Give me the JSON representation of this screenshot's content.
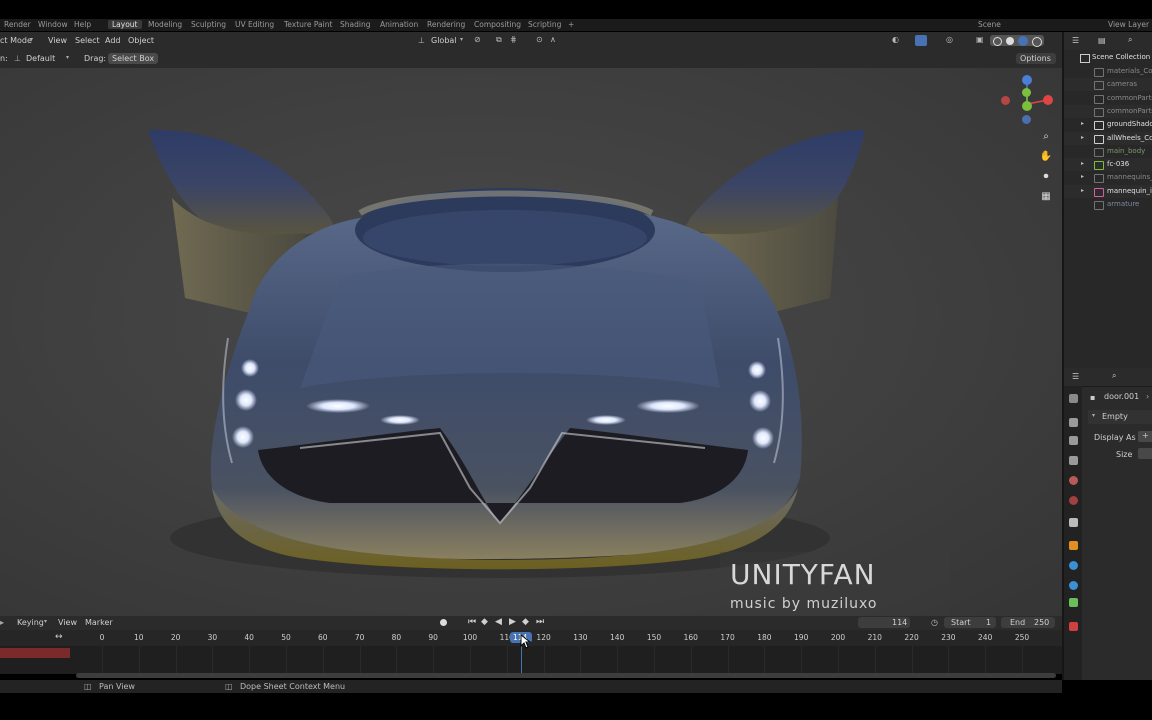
{
  "workspace_tabs": [
    "Layout",
    "Modeling",
    "Sculpting",
    "UV Editing",
    "Texture Paint",
    "Shading",
    "Animation",
    "Rendering",
    "Compositing",
    "Scripting",
    "+"
  ],
  "top_menu_partial": [
    "Render",
    "Window",
    "Help"
  ],
  "scene": {
    "label": "Scene",
    "view_layer": "View Layer"
  },
  "viewport_header": {
    "mode": "ct Mode",
    "menus": [
      "View",
      "Select",
      "Add",
      "Object"
    ],
    "orientation": "Global",
    "orientation_label": "n:",
    "orientation_value": "Default",
    "drag_label": "Drag:",
    "drag_value": "Select Box",
    "options": "Options"
  },
  "watermark": {
    "title": "UNITYFAN",
    "subtitle": "music by muziluxo"
  },
  "timeline": {
    "menus": [
      "Keying",
      "View",
      "Marker"
    ],
    "current_frame": "114",
    "start_label": "Start",
    "start_value": "1",
    "end_label": "End",
    "end_value": "250",
    "frame_marker": "114",
    "ticks": [
      "0",
      "10",
      "20",
      "30",
      "40",
      "50",
      "60",
      "70",
      "80",
      "90",
      "100",
      "110",
      "120",
      "130",
      "140",
      "150",
      "160",
      "170",
      "180",
      "190",
      "200",
      "210",
      "220",
      "230",
      "240",
      "250"
    ]
  },
  "status_bar": {
    "pan_view": "Pan View",
    "context_menu": "Dope Sheet Context Menu"
  },
  "outliner": {
    "title": "Scene Collection",
    "items": [
      {
        "label": "materials_Col",
        "enabled": false,
        "color": "#8a8a8a"
      },
      {
        "label": "cameras",
        "enabled": false,
        "color": "#8a8a8a"
      },
      {
        "label": "commonParts",
        "enabled": false,
        "color": "#8a8a8a"
      },
      {
        "label": "commonParts",
        "enabled": false,
        "color": "#8a8a8a"
      },
      {
        "label": "groundShadow",
        "enabled": true,
        "color": "#e0e0e0"
      },
      {
        "label": "allWheels_Col",
        "enabled": true,
        "color": "#e0e0e0"
      },
      {
        "label": "main_body",
        "enabled": false,
        "color": "#7a9a6a"
      },
      {
        "label": "fc-036",
        "enabled": true,
        "color": "#e0e0e0"
      },
      {
        "label": "mannequins_C",
        "enabled": false,
        "color": "#8a8a8a"
      },
      {
        "label": "mannequin_in",
        "enabled": true,
        "color": "#e0e0e0"
      },
      {
        "label": "armature",
        "enabled": false,
        "color": "#7a8aa0"
      }
    ]
  },
  "properties": {
    "object": "door.001",
    "section": "Empty",
    "display_as_label": "Display As",
    "size_label": "Size"
  },
  "colors": {
    "accent": "#4772b3",
    "x_axis": "#e04545",
    "y_axis": "#7bbf3c",
    "z_axis": "#4a7fd6"
  }
}
